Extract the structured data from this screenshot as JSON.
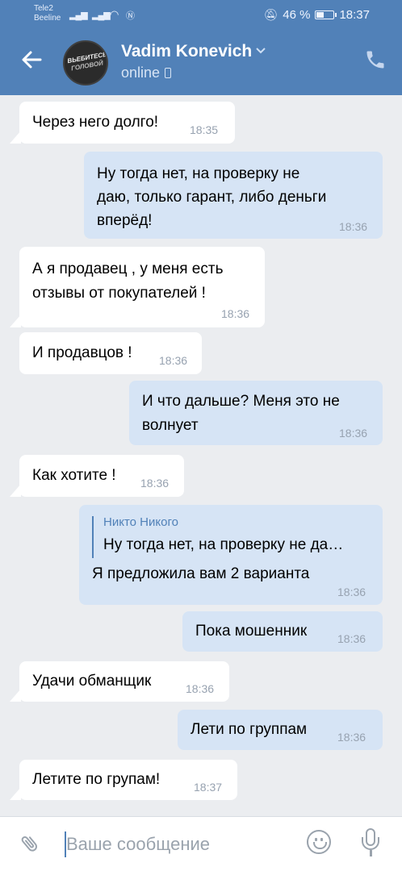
{
  "status_bar": {
    "carrier_1": "Tele2",
    "carrier_2": "Beeline",
    "battery_text": "46 %",
    "time": "18:37"
  },
  "chat_header": {
    "contact_name": "Vadim Konevich",
    "status": "online",
    "avatar_text_1": "ВЬЕБИТЕСЬ",
    "avatar_text_2": "ГОЛОВОЙ"
  },
  "messages": [
    {
      "direction": "in",
      "lines": [
        "Через него долго!"
      ],
      "time": "18:35"
    },
    {
      "direction": "out",
      "lines": [
        "Ну тогда нет, на проверку не",
        "даю, только гарант, либо деньги",
        "вперёд!"
      ],
      "time": "18:36"
    },
    {
      "direction": "in",
      "lines": [
        "А я продавец , у меня есть",
        "отзывы от покупателей !"
      ],
      "time": "18:36"
    },
    {
      "direction": "in",
      "lines": [
        "И продавцов !"
      ],
      "time": "18:36"
    },
    {
      "direction": "out",
      "lines": [
        "И что дальше? Меня это не",
        "волнует"
      ],
      "time": "18:36"
    },
    {
      "direction": "in",
      "lines": [
        "Как хотите !"
      ],
      "time": "18:36"
    },
    {
      "direction": "out",
      "quote_author": "Никто Никого",
      "quote_text": "Ну тогда нет, на проверку не да…",
      "lines": [
        "Я предложила вам 2 варианта"
      ],
      "time": "18:36"
    },
    {
      "direction": "out",
      "lines": [
        "Пока мошенник"
      ],
      "time": "18:36"
    },
    {
      "direction": "in",
      "lines": [
        "Удачи обманщик"
      ],
      "time": "18:36"
    },
    {
      "direction": "out",
      "lines": [
        "Лети по группам"
      ],
      "time": "18:36"
    },
    {
      "direction": "in",
      "lines": [
        "Летите по групам!"
      ],
      "time": "18:37"
    }
  ],
  "composer": {
    "placeholder": "Ваше сообщение"
  },
  "icons": {
    "back": "arrow-left-icon",
    "call": "phone-icon",
    "attach": "paperclip-icon",
    "emoji": "smiley-icon",
    "mic": "microphone-icon"
  },
  "colors": {
    "header": "#5181b8",
    "background": "#ebedf0",
    "incoming_bubble": "#ffffff",
    "outgoing_bubble": "#d6e4f5"
  }
}
